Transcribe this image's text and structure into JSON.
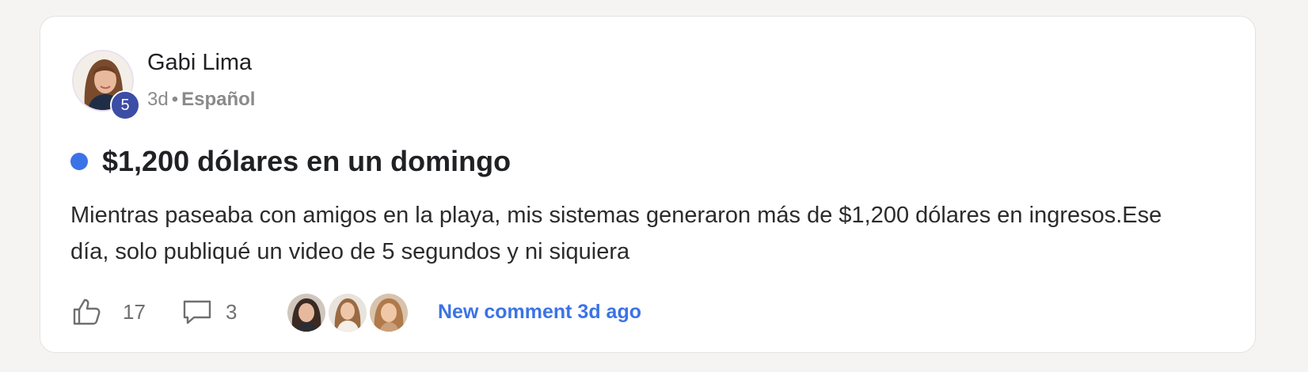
{
  "post": {
    "author": {
      "name": "Gabi Lima",
      "level": "5",
      "avatar_icon": "author-avatar"
    },
    "meta": {
      "time": "3d",
      "separator": "•",
      "category": "Español"
    },
    "unread": true,
    "title": "$1,200 dólares en un domingo",
    "body": "Mientras paseaba con amigos en la playa, mis sistemas generaron más de $1,200 dólares en ingresos.Ese día, solo publiqué un video de 5 segundos y ni siquiera",
    "actions": {
      "like_icon": "thumbs-up-icon",
      "likes": "17",
      "comment_icon": "comment-icon",
      "comments": "3"
    },
    "recent_commenters": [
      {
        "avatar_icon": "commenter-avatar-1"
      },
      {
        "avatar_icon": "commenter-avatar-2"
      },
      {
        "avatar_icon": "commenter-avatar-3"
      }
    ],
    "new_comment_text": "New comment 3d ago"
  },
  "colors": {
    "accent": "#3b73e6",
    "level_badge": "#3c4da5",
    "text": "#202124",
    "muted": "#8a8a8a",
    "background": "#f5f4f2",
    "card": "#ffffff"
  }
}
